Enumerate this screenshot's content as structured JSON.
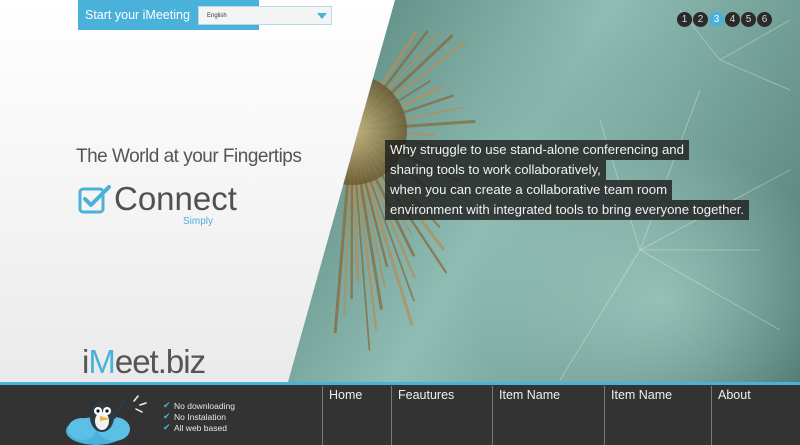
{
  "topbar": {
    "label": "Start your iMeeting",
    "language_value": "English"
  },
  "pager": {
    "pages": [
      "1",
      "2",
      "3",
      "4",
      "5",
      "6"
    ],
    "active": "3"
  },
  "hero": {
    "tagline": "The World at your Fingertips",
    "headline": "Connect",
    "subline": "Simply",
    "quote_lines": [
      "Why struggle to use stand-alone conferencing and",
      "sharing tools to work collaboratively,",
      "when you can create a collaborative team room",
      "environment with integrated tools to bring everyone together."
    ]
  },
  "logo": {
    "pre": "i",
    "accent": "M",
    "post": "eet.biz"
  },
  "features": [
    "No downloading",
    "No Instalation",
    "All web based"
  ],
  "nav": [
    "Home",
    "Feautures",
    "Item Name",
    "Item Name",
    "About"
  ],
  "colors": {
    "accent": "#49b1da",
    "footer": "#333333",
    "overlay": "#202020"
  }
}
